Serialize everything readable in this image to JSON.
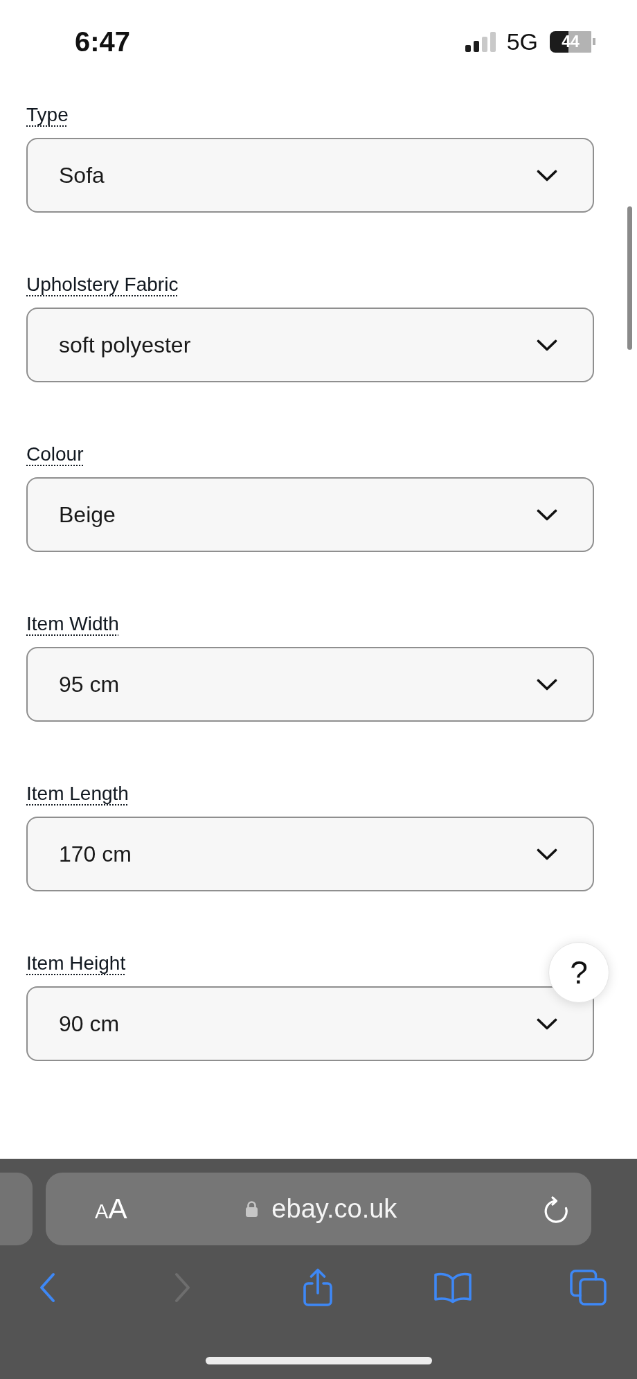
{
  "status_bar": {
    "time": "6:47",
    "network": "5G",
    "battery": "44"
  },
  "fields": [
    {
      "label": "Type",
      "value": "Sofa"
    },
    {
      "label": "Upholstery Fabric",
      "value": "soft polyester"
    },
    {
      "label": "Colour",
      "value": "Beige"
    },
    {
      "label": "Item Width",
      "value": "95 cm"
    },
    {
      "label": "Item Length",
      "value": "170 cm"
    },
    {
      "label": "Item Height",
      "value": "90 cm"
    }
  ],
  "help_button": {
    "label": "?"
  },
  "browser_bar": {
    "text_size": "AA",
    "address": "ebay.co.uk",
    "nav_buttons": [
      {
        "kind": "back",
        "disabled": false
      },
      {
        "kind": "forward",
        "disabled": true
      },
      {
        "kind": "share",
        "disabled": false
      },
      {
        "kind": "bookmarks",
        "disabled": false
      },
      {
        "kind": "tabs",
        "disabled": false
      }
    ]
  }
}
